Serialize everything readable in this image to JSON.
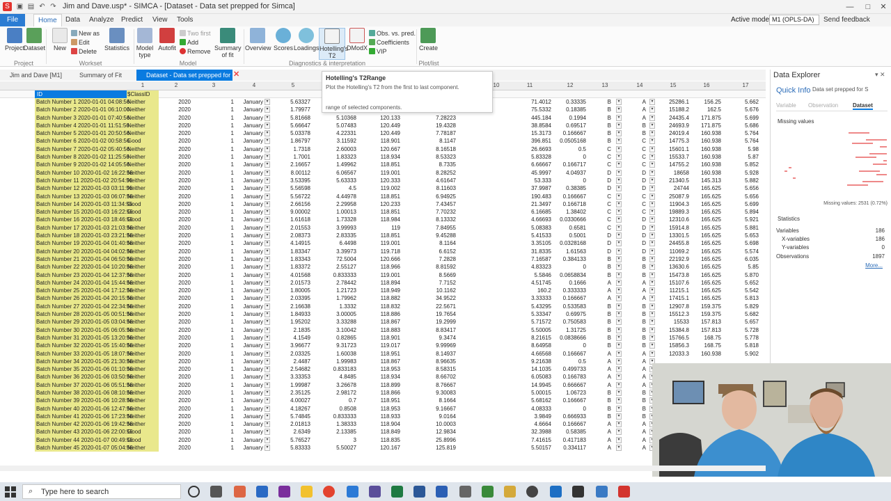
{
  "window": {
    "title": "Jim and Dave.usp* - SIMCA - [Dataset - Data set prepped for Simca]",
    "controls": [
      "—",
      "□",
      "✕"
    ]
  },
  "menu": {
    "file": "File",
    "tabs": [
      "Home",
      "Data",
      "Analyze",
      "Predict",
      "View",
      "Tools"
    ],
    "active_model_label": "Active model:",
    "active_model_value": "M1 (OPLS-DA)",
    "send_feedback": "Send feedback"
  },
  "ribbon": {
    "project_label": "Project",
    "dataset_label": "Dataset",
    "new_label": "New",
    "new_as": "New as",
    "edit": "Edit",
    "delete": "Delete",
    "statistics_label": "Statistics",
    "workset_group": "Workset",
    "model_type": "Model type",
    "autofit": "Autofit",
    "two_first": "Two first",
    "add": "Add",
    "remove": "Remove",
    "summary_fit": "Summary of fit",
    "model_group": "Model",
    "overview": "Overview",
    "scores": "Scores",
    "loadings": "Loadings",
    "hotellings": "Hotelling's T2",
    "dmod": "DModX",
    "obs_pred": "Obs. vs. pred.",
    "coefficients": "Coefficients",
    "vip": "VIP",
    "diag_group": "Diagnostics & interpretation",
    "create": "Create",
    "plotlist_group": "Plot/list"
  },
  "doc_tabs": [
    "Jim and Dave [M1]",
    "Summary of Fit [M1]",
    "Dataset - Data set prepped for ..."
  ],
  "tooltip": {
    "title": "Hotelling's T2Range",
    "description": "Plot the Hotelling's T2 from the first to last component.",
    "faded": "range of selected components."
  },
  "grid": {
    "col_numbers": [
      "1",
      "2",
      "3",
      "4",
      "5",
      "6",
      "7",
      "8",
      "9",
      "10",
      "11",
      "12",
      "13",
      "14",
      "15",
      "16",
      "17"
    ],
    "header_id": "ID",
    "header_class": "$ClassID",
    "rows": [
      [
        "Batch Number 1 2020-01-01 04:08:56",
        "Neither",
        "2020",
        "1",
        "January",
        "5.63327",
        "120.367",
        "7.94915",
        "2027",
        "71.4012",
        "0.33335",
        "B",
        "A",
        "25286.1",
        "156.25",
        "5.662"
      ],
      [
        "Batch Number 2 2020-01-01 06:10:00",
        "Neither",
        "2020",
        "1",
        "January",
        "1.79977",
        "3.18323",
        "120.367",
        "7.4493",
        "75.5332",
        "0.18385",
        "B",
        "A",
        "15188.2",
        "162.5",
        "5.676"
      ],
      [
        "Batch Number 3 2020-01-01 07:40:56",
        "Neither",
        "2020",
        "1",
        "January",
        "5.81668",
        "5.10368",
        "120.133",
        "7.28223",
        "445.184",
        "0.1994",
        "B",
        "A",
        "24435.4",
        "171.875",
        "5.699"
      ],
      [
        "Batch Number 4 2020-01-01 11:51:56",
        "Neither",
        "2020",
        "1",
        "January",
        "5.66647",
        "5.07483",
        "120.449",
        "19.4328",
        "38.8584",
        "0.69517",
        "B",
        "B",
        "24693.9",
        "171.875",
        "5.686"
      ],
      [
        "Batch Number 5 2020-01-01 20:50:56",
        "Neither",
        "2020",
        "1",
        "January",
        "5.03378",
        "4.22331",
        "120.449",
        "7.78187",
        "15.3173",
        "0.166667",
        "B",
        "B",
        "24019.4",
        "160.938",
        "5.764"
      ],
      [
        "Batch Number 6 2020-01-02 00:58:56",
        "Good",
        "2020",
        "1",
        "January",
        "1.86797",
        "3.11592",
        "118.901",
        "8.1147",
        "396.851",
        "0.0505168",
        "B",
        "C",
        "14775.3",
        "160.938",
        "5.764"
      ],
      [
        "Batch Number 7 2020-01-02 05:40:56",
        "Neither",
        "2020",
        "1",
        "January",
        "1.7318",
        "2.60003",
        "120.667",
        "8.16518",
        "26.6693",
        "0.5",
        "C",
        "C",
        "15601.1",
        "160.938",
        "5.98"
      ],
      [
        "Batch Number 8 2020-01-02 11:25:56",
        "Neither",
        "2020",
        "1",
        "January",
        "1.7001",
        "1.83323",
        "118.934",
        "8.53323",
        "5.83328",
        "0",
        "C",
        "C",
        "15533.7",
        "160.938",
        "5.87"
      ],
      [
        "Batch Number 9 2020-01-02 14:05:56",
        "Neither",
        "2020",
        "1",
        "January",
        "2.16657",
        "1.49962",
        "118.851",
        "8.7335",
        "6.66667",
        "0.166717",
        "C",
        "C",
        "14755.2",
        "160.938",
        "5.852"
      ],
      [
        "Batch Number 10 2020-01-02 16:22:56",
        "Neither",
        "2020",
        "1",
        "January",
        "8.00112",
        "6.06567",
        "119.001",
        "8.28252",
        "45.9997",
        "4.04937",
        "D",
        "D",
        "18658",
        "160.938",
        "5.928"
      ],
      [
        "Batch Number 11 2020-01-02 20:54:56",
        "Neither",
        "2020",
        "1",
        "January",
        "3.53395",
        "5.63333",
        "120.333",
        "4.61647",
        "53.333",
        "0",
        "D",
        "D",
        "21340.5",
        "145.313",
        "5.882"
      ],
      [
        "Batch Number 12 2020-01-03 03:11:56",
        "Neither",
        "2020",
        "1",
        "January",
        "5.56598",
        "4.5",
        "119.002",
        "8.11603",
        "37.9987",
        "0.38385",
        "D",
        "D",
        "24744",
        "165.625",
        "5.656"
      ],
      [
        "Batch Number 13 2020-01-03 06:07:56",
        "Neither",
        "2020",
        "1",
        "January",
        "5.56722",
        "4.44978",
        "118.851",
        "6.94925",
        "190.483",
        "0.166667",
        "C",
        "C",
        "25087.9",
        "165.625",
        "5.656"
      ],
      [
        "Batch Number 14 2020-01-03 11:34:56",
        "Good",
        "2020",
        "1",
        "January",
        "2.66156",
        "2.29958",
        "120.233",
        "7.43457",
        "21.3497",
        "0.166718",
        "C",
        "C",
        "11904.3",
        "165.625",
        "5.699"
      ],
      [
        "Batch Number 15 2020-01-03 16:22:56",
        "Good",
        "2020",
        "1",
        "January",
        "9.00002",
        "1.00013",
        "118.851",
        "7.70232",
        "6.16685",
        "1.38402",
        "C",
        "C",
        "19889.3",
        "165.625",
        "5.894"
      ],
      [
        "Batch Number 16 2020-01-03 18:46:56",
        "Good",
        "2020",
        "1",
        "January",
        "1.61618",
        "1.73328",
        "118.984",
        "8.13332",
        "4.66693",
        "0.0330666",
        "C",
        "D",
        "12310.6",
        "165.625",
        "5.921"
      ],
      [
        "Batch Number 17 2020-01-03 21:03:56",
        "Neither",
        "2020",
        "1",
        "January",
        "2.01553",
        "3.99993",
        "119",
        "7.84955",
        "5.08383",
        "0.6581",
        "C",
        "D",
        "15914.8",
        "165.625",
        "5.881"
      ],
      [
        "Batch Number 18 2020-01-03 23:21:56",
        "Neither",
        "2020",
        "1",
        "January",
        "2.08373",
        "2.83335",
        "118.851",
        "9.45288",
        "5.41533",
        "0.5001",
        "D",
        "D",
        "13301.5",
        "165.625",
        "5.653"
      ],
      [
        "Batch Number 19 2020-01-04 01:40:56",
        "Neither",
        "2020",
        "1",
        "January",
        "4.14915",
        "6.4498",
        "119.001",
        "8.1164",
        "3.35105",
        "0.0328168",
        "D",
        "D",
        "24455.8",
        "165.625",
        "5.698"
      ],
      [
        "Batch Number 20 2020-01-04 04:02:56",
        "Neither",
        "2020",
        "1",
        "January",
        "1.83347",
        "3.39973",
        "119.718",
        "6.6152",
        "31.8335",
        "1.61563",
        "D",
        "D",
        "11069.2",
        "165.625",
        "5.574"
      ],
      [
        "Batch Number 21 2020-01-04 06:50:56",
        "Neither",
        "2020",
        "1",
        "January",
        "1.83343",
        "72.5004",
        "120.666",
        "7.2828",
        "7.16587",
        "0.384133",
        "B",
        "B",
        "22192.9",
        "165.625",
        "6.035"
      ],
      [
        "Batch Number 22 2020-01-04 10:20:56",
        "Neither",
        "2020",
        "1",
        "January",
        "1.83372",
        "2.55127",
        "118.966",
        "8.81592",
        "4.83323",
        "0",
        "B",
        "B",
        "13630.6",
        "165.625",
        "5.85"
      ],
      [
        "Batch Number 23 2020-01-04 12:37:56",
        "Neither",
        "2020",
        "1",
        "January",
        "4.01568",
        "0.833333",
        "119.001",
        "8.5669",
        "5.5846",
        "0.0658834",
        "B",
        "B",
        "15473.8",
        "165.625",
        "5.870"
      ],
      [
        "Batch Number 24 2020-01-04 15:44:56",
        "Neither",
        "2020",
        "1",
        "January",
        "2.01573",
        "2.78442",
        "118.894",
        "7.7152",
        "4.51745",
        "0.1666",
        "A",
        "A",
        "15107.6",
        "165.625",
        "5.652"
      ],
      [
        "Batch Number 25 2020-01-04 17:12:56",
        "Neither",
        "2020",
        "1",
        "January",
        "1.80005",
        "1.21723",
        "118.949",
        "10.1162",
        "160.2",
        "0.333333",
        "A",
        "A",
        "11215.1",
        "165.625",
        "5.542"
      ],
      [
        "Batch Number 26 2020-01-04 20:15:56",
        "Neither",
        "2020",
        "1",
        "January",
        "2.03395",
        "1.79962",
        "118.882",
        "34.9522",
        "3.33333",
        "0.166667",
        "A",
        "A",
        "17415.1",
        "165.625",
        "5.813"
      ],
      [
        "Batch Number 27 2020-01-04 22:34:56",
        "Neither",
        "2020",
        "1",
        "January",
        "2.16638",
        "1.3332",
        "118.832",
        "22.5671",
        "5.43295",
        "0.533583",
        "B",
        "B",
        "12907.8",
        "159.375",
        "5.829"
      ],
      [
        "Batch Number 28 2020-01-05 00:51:56",
        "Neither",
        "2020",
        "1",
        "January",
        "1.84933",
        "3.00005",
        "118.886",
        "19.7654",
        "5.33347",
        "0.69975",
        "B",
        "B",
        "15512.3",
        "159.375",
        "5.682"
      ],
      [
        "Batch Number 29 2020-01-05 03:04:56",
        "Neither",
        "2020",
        "1",
        "January",
        "1.95202",
        "3.33288",
        "118.867",
        "19.2999",
        "5.71572",
        "0.750583",
        "B",
        "B",
        "15533",
        "157.813",
        "5.657"
      ],
      [
        "Batch Number 30 2020-01-05 06:05:56",
        "Neither",
        "2020",
        "1",
        "January",
        "2.1835",
        "3.10042",
        "118.883",
        "8.83417",
        "5.50005",
        "1.31725",
        "B",
        "B",
        "15384.8",
        "157.813",
        "5.728"
      ],
      [
        "Batch Number 31 2020-01-05 13:20:56",
        "Neither",
        "2020",
        "1",
        "January",
        "4.1549",
        "0.82865",
        "118.901",
        "9.3474",
        "8.21615",
        "0.0838666",
        "B",
        "B",
        "15766.5",
        "168.75",
        "5.778"
      ],
      [
        "Batch Number 32 2020-01-05 15:40:56",
        "Neither",
        "2020",
        "1",
        "January",
        "3.96677",
        "9.31723",
        "119.017",
        "9.99969",
        "8.64958",
        "0",
        "B",
        "B",
        "15856.3",
        "168.75",
        "5.818"
      ],
      [
        "Batch Number 33 2020-01-05 18:07:56",
        "Neither",
        "2020",
        "1",
        "January",
        "2.03325",
        "1.60038",
        "118.951",
        "8.14937",
        "4.66568",
        "0.166667",
        "A",
        "A",
        "12033.3",
        "160.938",
        "5.902"
      ],
      [
        "Batch Number 34 2020-01-05 21:30:56",
        "Neither",
        "2020",
        "1",
        "January",
        "2.4487",
        "1.99983",
        "118.867",
        "8.96635",
        "9.21638",
        "0.5",
        "A",
        "A",
        "",
        "",
        ""
      ],
      [
        "Batch Number 35 2020-01-06 01:10:56",
        "Neither",
        "2020",
        "1",
        "January",
        "2.54682",
        "0.833183",
        "118.953",
        "8.58315",
        "14.1035",
        "0.499733",
        "A",
        "A",
        "",
        "",
        ""
      ],
      [
        "Batch Number 36 2020-01-06 03:50:56",
        "Neither",
        "2020",
        "1",
        "January",
        "3.33353",
        "4.8485",
        "118.934",
        "8.66702",
        "6.05083",
        "0.166783",
        "A",
        "A",
        "",
        "",
        ""
      ],
      [
        "Batch Number 37 2020-01-06 05:51:56",
        "Neither",
        "2020",
        "1",
        "January",
        "1.99987",
        "3.26678",
        "118.899",
        "8.76667",
        "14.9945",
        "0.666667",
        "A",
        "A",
        "",
        "",
        ""
      ],
      [
        "Batch Number 38 2020-01-06 08:10:56",
        "Neither",
        "2020",
        "1",
        "January",
        "2.35125",
        "2.98172",
        "118.866",
        "9.30083",
        "5.00015",
        "1.06723",
        "B",
        "B",
        "",
        "",
        ""
      ],
      [
        "Batch Number 39 2020-01-06 10:28:56",
        "Neither",
        "2020",
        "1",
        "January",
        "4.00027",
        "0.7",
        "118.951",
        "8.1664",
        "5.68162",
        "0.166667",
        "B",
        "B",
        "",
        "",
        ""
      ],
      [
        "Batch Number 40 2020-01-06 12:47:56",
        "Neither",
        "2020",
        "1",
        "January",
        "4.18267",
        "0.8508",
        "118.953",
        "9.16667",
        "4.08333",
        "0",
        "B",
        "B",
        "",
        "",
        ""
      ],
      [
        "Batch Number 41 2020-01-06 17:23:56",
        "Neither",
        "2020",
        "1",
        "January",
        "5.74845",
        "0.833333",
        "118.933",
        "9.0164",
        "3.9849",
        "0.666933",
        "B",
        "B",
        "",
        "",
        ""
      ],
      [
        "Batch Number 42 2020-01-06 19:42:56",
        "Neither",
        "2020",
        "1",
        "January",
        "2.01813",
        "1.38333",
        "118.904",
        "10.0003",
        "4.6664",
        "0.166667",
        "A",
        "A",
        "",
        "",
        ""
      ],
      [
        "Batch Number 43 2020-01-06 22:00:56",
        "Good",
        "2020",
        "1",
        "January",
        "2.6349",
        "2.13385",
        "118.849",
        "12.9834",
        "32.3988",
        "0.58385",
        "A",
        "A",
        "",
        "",
        ""
      ],
      [
        "Batch Number 44 2020-01-07 00:49:56",
        "Good",
        "2020",
        "1",
        "January",
        "5.76527",
        "3",
        "118.835",
        "25.8996",
        "7.41615",
        "0.417183",
        "A",
        "A",
        "",
        "",
        ""
      ],
      [
        "Batch Number 45 2020-01-07 05:04:56",
        "Neither",
        "2020",
        "1",
        "January",
        "5.83333",
        "5.50027",
        "120.167",
        "125.819",
        "5.50157",
        "0.334117",
        "A",
        "A",
        "",
        "",
        ""
      ]
    ]
  },
  "explorer": {
    "title": "Data Explorer",
    "quick_info": "Quick Info",
    "quick_select": "Data set prepped for S",
    "tabs": [
      "Variable",
      "Observation",
      "Dataset"
    ],
    "missing_head": "Missing values",
    "missing_foot": "Missing values: 2531 (0.72%)",
    "stats_head": "Statistics",
    "stats": [
      {
        "k": "Variables",
        "v": "186"
      },
      {
        "k": "X-variables",
        "v": "186"
      },
      {
        "k": "Y-variables",
        "v": "0"
      },
      {
        "k": "Observations",
        "v": "1897"
      }
    ],
    "more": "More..."
  },
  "taskbar": {
    "search_placeholder": "Type here to search"
  }
}
